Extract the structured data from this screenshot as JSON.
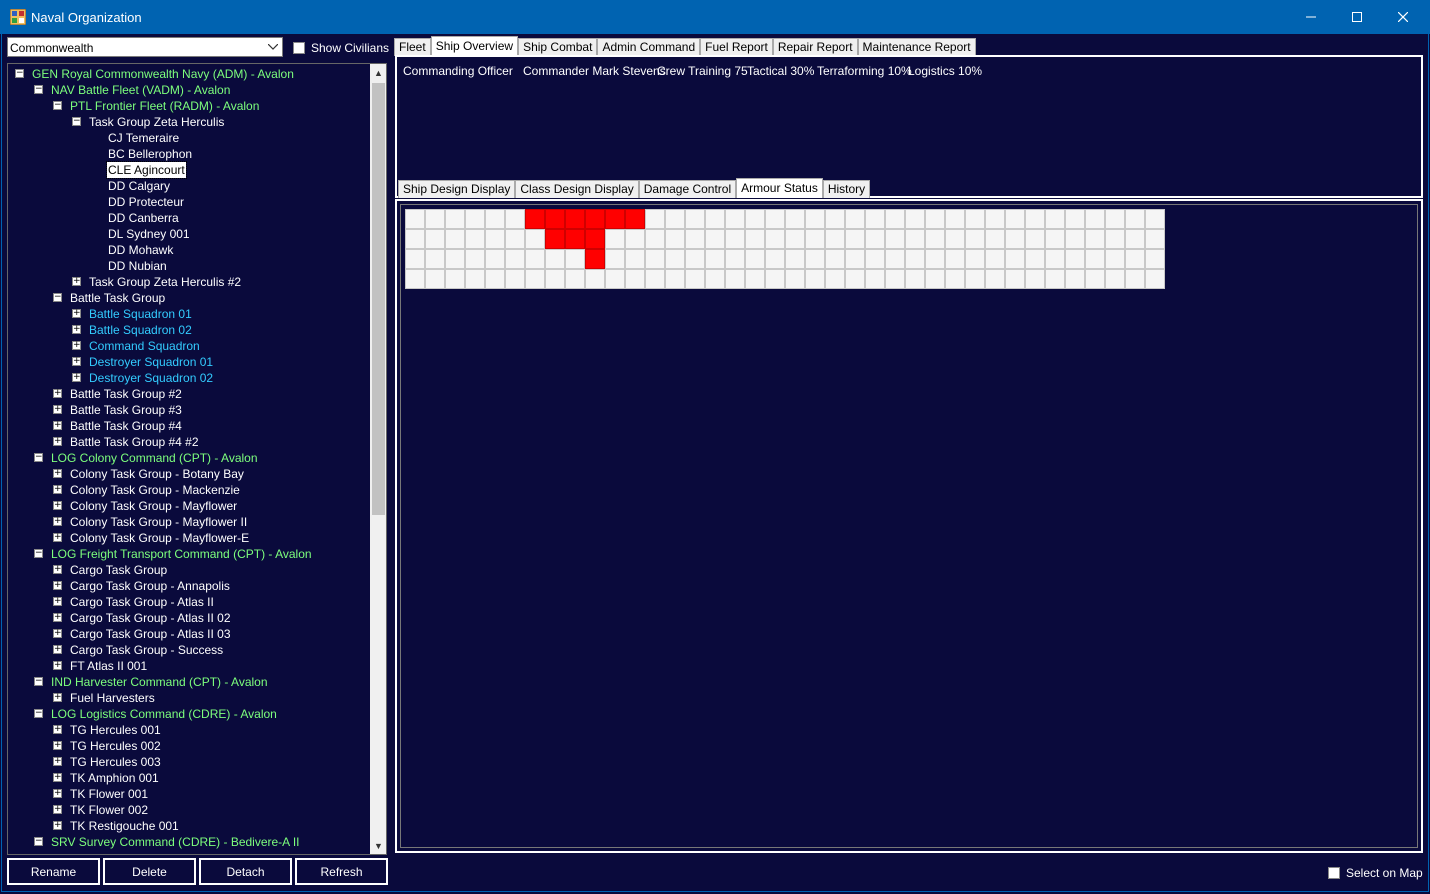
{
  "window": {
    "title": "Naval Organization"
  },
  "race_selector": {
    "value": "Commonwealth"
  },
  "show_civilians": {
    "label": "Show Civilians",
    "checked": false
  },
  "tree": [
    {
      "label": "GEN Royal Commonwealth Navy  (ADM)  -  Avalon",
      "color": "green",
      "toggle": "−"
    },
    {
      "label": "NAV Battle Fleet  (VADM)  -  Avalon",
      "color": "green",
      "toggle": "−"
    },
    {
      "label": "PTL Frontier Fleet  (RADM)  -  Avalon",
      "color": "green",
      "toggle": "−"
    },
    {
      "label": "Task Group Zeta Herculis",
      "color": "white",
      "toggle": "−"
    },
    {
      "label": "CJ Temeraire",
      "color": "white",
      "toggle": ""
    },
    {
      "label": "BC Bellerophon",
      "color": "white",
      "toggle": ""
    },
    {
      "label": "CLE Agincourt",
      "color": "white",
      "toggle": "",
      "selected": true
    },
    {
      "label": "DD Calgary",
      "color": "white",
      "toggle": ""
    },
    {
      "label": "DD Protecteur",
      "color": "white",
      "toggle": ""
    },
    {
      "label": "DD Canberra",
      "color": "white",
      "toggle": ""
    },
    {
      "label": "DL Sydney 001",
      "color": "white",
      "toggle": ""
    },
    {
      "label": "DD Mohawk",
      "color": "white",
      "toggle": ""
    },
    {
      "label": "DD Nubian",
      "color": "white",
      "toggle": ""
    },
    {
      "label": "Task Group Zeta Herculis #2",
      "color": "white",
      "toggle": "+"
    },
    {
      "label": "Battle Task Group",
      "color": "white",
      "toggle": "−"
    },
    {
      "label": "Battle Squadron 01",
      "color": "cyan",
      "toggle": "+"
    },
    {
      "label": "Battle Squadron 02",
      "color": "cyan",
      "toggle": "+"
    },
    {
      "label": "Command Squadron",
      "color": "cyan",
      "toggle": "+"
    },
    {
      "label": "Destroyer Squadron 01",
      "color": "cyan",
      "toggle": "+"
    },
    {
      "label": "Destroyer Squadron 02",
      "color": "cyan",
      "toggle": "+"
    },
    {
      "label": "Battle Task Group #2",
      "color": "white",
      "toggle": "+"
    },
    {
      "label": "Battle Task Group #3",
      "color": "white",
      "toggle": "+"
    },
    {
      "label": "Battle Task Group #4",
      "color": "white",
      "toggle": "+"
    },
    {
      "label": "Battle Task Group #4 #2",
      "color": "white",
      "toggle": "+"
    },
    {
      "label": "LOG Colony Command  (CPT)  -  Avalon",
      "color": "green",
      "toggle": "−"
    },
    {
      "label": "Colony Task Group - Botany Bay",
      "color": "white",
      "toggle": "+"
    },
    {
      "label": "Colony Task Group - Mackenzie",
      "color": "white",
      "toggle": "+"
    },
    {
      "label": "Colony Task Group - Mayflower",
      "color": "white",
      "toggle": "+"
    },
    {
      "label": "Colony Task Group - Mayflower II",
      "color": "white",
      "toggle": "+"
    },
    {
      "label": "Colony Task Group - Mayflower-E",
      "color": "white",
      "toggle": "+"
    },
    {
      "label": "LOG Freight Transport Command  (CPT)  -  Avalon",
      "color": "green",
      "toggle": "−"
    },
    {
      "label": "Cargo Task Group",
      "color": "white",
      "toggle": "+"
    },
    {
      "label": "Cargo Task Group - Annapolis",
      "color": "white",
      "toggle": "+"
    },
    {
      "label": "Cargo Task Group - Atlas II",
      "color": "white",
      "toggle": "+"
    },
    {
      "label": "Cargo Task Group - Atlas II 02",
      "color": "white",
      "toggle": "+"
    },
    {
      "label": "Cargo Task Group - Atlas II 03",
      "color": "white",
      "toggle": "+"
    },
    {
      "label": "Cargo Task Group - Success",
      "color": "white",
      "toggle": "+"
    },
    {
      "label": "FT Atlas II 001",
      "color": "white",
      "toggle": "+"
    },
    {
      "label": "IND Harvester Command  (CPT)  -  Avalon",
      "color": "green",
      "toggle": "−"
    },
    {
      "label": "Fuel Harvesters",
      "color": "white",
      "toggle": "+"
    },
    {
      "label": "LOG Logistics Command  (CDRE)  -  Avalon",
      "color": "green",
      "toggle": "−"
    },
    {
      "label": "TG Hercules 001",
      "color": "white",
      "toggle": "+"
    },
    {
      "label": "TG Hercules 002",
      "color": "white",
      "toggle": "+"
    },
    {
      "label": "TG Hercules 003",
      "color": "white",
      "toggle": "+"
    },
    {
      "label": "TK Amphion 001",
      "color": "white",
      "toggle": "+"
    },
    {
      "label": "TK Flower 001",
      "color": "white",
      "toggle": "+"
    },
    {
      "label": "TK Flower 002",
      "color": "white",
      "toggle": "+"
    },
    {
      "label": "TK Restigouche 001",
      "color": "white",
      "toggle": "+"
    },
    {
      "label": "SRV Survey Command  (CDRE)  -  Bedivere-A II",
      "color": "green",
      "toggle": "−"
    }
  ],
  "buttons": {
    "rename": "Rename",
    "delete": "Delete",
    "detach": "Detach",
    "refresh": "Refresh"
  },
  "main_tabs": [
    "Fleet",
    "Ship Overview",
    "Ship Combat",
    "Admin Command",
    "Fuel Report",
    "Repair Report",
    "Maintenance Report"
  ],
  "main_tab_active": 1,
  "overview": {
    "commanding_officer_label": "Commanding Officer",
    "commander": "Commander Mark Stevens",
    "crew_training": "Crew Training 75",
    "tactical": "Tactical 30%",
    "terraforming": "Terraforming 10%",
    "logistics": "Logistics 10%"
  },
  "sub_tabs": [
    "Ship Design Display",
    "Class Design Display",
    "Damage Control",
    "Armour Status",
    "History"
  ],
  "sub_tab_active": 3,
  "armour": {
    "columns": 38,
    "rows": 4,
    "damaged": [
      [
        0,
        6
      ],
      [
        0,
        7
      ],
      [
        0,
        8
      ],
      [
        0,
        9
      ],
      [
        0,
        10
      ],
      [
        0,
        11
      ],
      [
        1,
        7
      ],
      [
        1,
        8
      ],
      [
        1,
        9
      ],
      [
        2,
        9
      ]
    ],
    "colors": {
      "intact": "#f5f5f5",
      "damaged": "#ff0000"
    }
  },
  "select_on_map": {
    "label": "Select on Map",
    "checked": false
  }
}
